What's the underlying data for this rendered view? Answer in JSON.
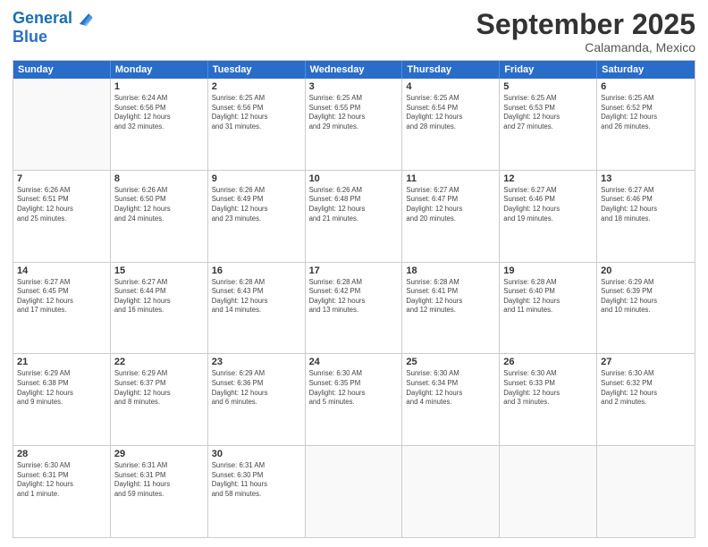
{
  "header": {
    "logo_line1": "General",
    "logo_line2": "Blue",
    "month": "September 2025",
    "location": "Calamanda, Mexico"
  },
  "weekdays": [
    "Sunday",
    "Monday",
    "Tuesday",
    "Wednesday",
    "Thursday",
    "Friday",
    "Saturday"
  ],
  "rows": [
    [
      {
        "day": "",
        "info": ""
      },
      {
        "day": "1",
        "info": "Sunrise: 6:24 AM\nSunset: 6:56 PM\nDaylight: 12 hours\nand 32 minutes."
      },
      {
        "day": "2",
        "info": "Sunrise: 6:25 AM\nSunset: 6:56 PM\nDaylight: 12 hours\nand 31 minutes."
      },
      {
        "day": "3",
        "info": "Sunrise: 6:25 AM\nSunset: 6:55 PM\nDaylight: 12 hours\nand 29 minutes."
      },
      {
        "day": "4",
        "info": "Sunrise: 6:25 AM\nSunset: 6:54 PM\nDaylight: 12 hours\nand 28 minutes."
      },
      {
        "day": "5",
        "info": "Sunrise: 6:25 AM\nSunset: 6:53 PM\nDaylight: 12 hours\nand 27 minutes."
      },
      {
        "day": "6",
        "info": "Sunrise: 6:25 AM\nSunset: 6:52 PM\nDaylight: 12 hours\nand 26 minutes."
      }
    ],
    [
      {
        "day": "7",
        "info": "Sunrise: 6:26 AM\nSunset: 6:51 PM\nDaylight: 12 hours\nand 25 minutes."
      },
      {
        "day": "8",
        "info": "Sunrise: 6:26 AM\nSunset: 6:50 PM\nDaylight: 12 hours\nand 24 minutes."
      },
      {
        "day": "9",
        "info": "Sunrise: 6:26 AM\nSunset: 6:49 PM\nDaylight: 12 hours\nand 23 minutes."
      },
      {
        "day": "10",
        "info": "Sunrise: 6:26 AM\nSunset: 6:48 PM\nDaylight: 12 hours\nand 21 minutes."
      },
      {
        "day": "11",
        "info": "Sunrise: 6:27 AM\nSunset: 6:47 PM\nDaylight: 12 hours\nand 20 minutes."
      },
      {
        "day": "12",
        "info": "Sunrise: 6:27 AM\nSunset: 6:46 PM\nDaylight: 12 hours\nand 19 minutes."
      },
      {
        "day": "13",
        "info": "Sunrise: 6:27 AM\nSunset: 6:46 PM\nDaylight: 12 hours\nand 18 minutes."
      }
    ],
    [
      {
        "day": "14",
        "info": "Sunrise: 6:27 AM\nSunset: 6:45 PM\nDaylight: 12 hours\nand 17 minutes."
      },
      {
        "day": "15",
        "info": "Sunrise: 6:27 AM\nSunset: 6:44 PM\nDaylight: 12 hours\nand 16 minutes."
      },
      {
        "day": "16",
        "info": "Sunrise: 6:28 AM\nSunset: 6:43 PM\nDaylight: 12 hours\nand 14 minutes."
      },
      {
        "day": "17",
        "info": "Sunrise: 6:28 AM\nSunset: 6:42 PM\nDaylight: 12 hours\nand 13 minutes."
      },
      {
        "day": "18",
        "info": "Sunrise: 6:28 AM\nSunset: 6:41 PM\nDaylight: 12 hours\nand 12 minutes."
      },
      {
        "day": "19",
        "info": "Sunrise: 6:28 AM\nSunset: 6:40 PM\nDaylight: 12 hours\nand 11 minutes."
      },
      {
        "day": "20",
        "info": "Sunrise: 6:29 AM\nSunset: 6:39 PM\nDaylight: 12 hours\nand 10 minutes."
      }
    ],
    [
      {
        "day": "21",
        "info": "Sunrise: 6:29 AM\nSunset: 6:38 PM\nDaylight: 12 hours\nand 9 minutes."
      },
      {
        "day": "22",
        "info": "Sunrise: 6:29 AM\nSunset: 6:37 PM\nDaylight: 12 hours\nand 8 minutes."
      },
      {
        "day": "23",
        "info": "Sunrise: 6:29 AM\nSunset: 6:36 PM\nDaylight: 12 hours\nand 6 minutes."
      },
      {
        "day": "24",
        "info": "Sunrise: 6:30 AM\nSunset: 6:35 PM\nDaylight: 12 hours\nand 5 minutes."
      },
      {
        "day": "25",
        "info": "Sunrise: 6:30 AM\nSunset: 6:34 PM\nDaylight: 12 hours\nand 4 minutes."
      },
      {
        "day": "26",
        "info": "Sunrise: 6:30 AM\nSunset: 6:33 PM\nDaylight: 12 hours\nand 3 minutes."
      },
      {
        "day": "27",
        "info": "Sunrise: 6:30 AM\nSunset: 6:32 PM\nDaylight: 12 hours\nand 2 minutes."
      }
    ],
    [
      {
        "day": "28",
        "info": "Sunrise: 6:30 AM\nSunset: 6:31 PM\nDaylight: 12 hours\nand 1 minute."
      },
      {
        "day": "29",
        "info": "Sunrise: 6:31 AM\nSunset: 6:31 PM\nDaylight: 11 hours\nand 59 minutes."
      },
      {
        "day": "30",
        "info": "Sunrise: 6:31 AM\nSunset: 6:30 PM\nDaylight: 11 hours\nand 58 minutes."
      },
      {
        "day": "",
        "info": ""
      },
      {
        "day": "",
        "info": ""
      },
      {
        "day": "",
        "info": ""
      },
      {
        "day": "",
        "info": ""
      }
    ]
  ]
}
